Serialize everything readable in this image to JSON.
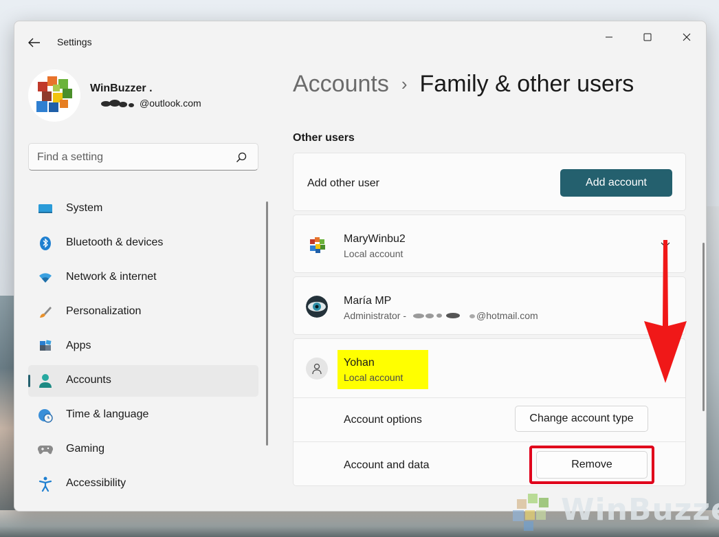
{
  "window": {
    "title": "Settings"
  },
  "profile": {
    "name": "WinBuzzer .",
    "email_suffix": "@outlook.com"
  },
  "search": {
    "placeholder": "Find a setting"
  },
  "nav": {
    "items": [
      {
        "label": "System",
        "icon": "system-icon",
        "active": false
      },
      {
        "label": "Bluetooth & devices",
        "icon": "bluetooth-icon",
        "active": false
      },
      {
        "label": "Network & internet",
        "icon": "wifi-icon",
        "active": false
      },
      {
        "label": "Personalization",
        "icon": "brush-icon",
        "active": false
      },
      {
        "label": "Apps",
        "icon": "apps-icon",
        "active": false
      },
      {
        "label": "Accounts",
        "icon": "accounts-icon",
        "active": true
      },
      {
        "label": "Time & language",
        "icon": "globe-clock-icon",
        "active": false
      },
      {
        "label": "Gaming",
        "icon": "gamepad-icon",
        "active": false
      },
      {
        "label": "Accessibility",
        "icon": "accessibility-icon",
        "active": false
      }
    ]
  },
  "breadcrumb": {
    "parent": "Accounts",
    "separator": "›",
    "current": "Family & other users"
  },
  "section": {
    "title": "Other users"
  },
  "add_user": {
    "label": "Add other user",
    "button": "Add account"
  },
  "users": [
    {
      "name": "MaryWinbu2",
      "sub": "Local account",
      "expanded": false
    },
    {
      "name": "María MP",
      "sub_prefix": "Administrator -",
      "sub_suffix": "@hotmail.com",
      "expanded": false
    },
    {
      "name": "Yohan",
      "sub": "Local account",
      "expanded": true
    }
  ],
  "expanded_options": {
    "account_options_label": "Account options",
    "change_type_button": "Change account type",
    "account_data_label": "Account and data",
    "remove_button": "Remove"
  },
  "watermark": {
    "text": "WinBuzzer"
  },
  "colors": {
    "accent": "#24606e",
    "highlight": "#ffff00",
    "annotation_red": "#e0001b"
  }
}
